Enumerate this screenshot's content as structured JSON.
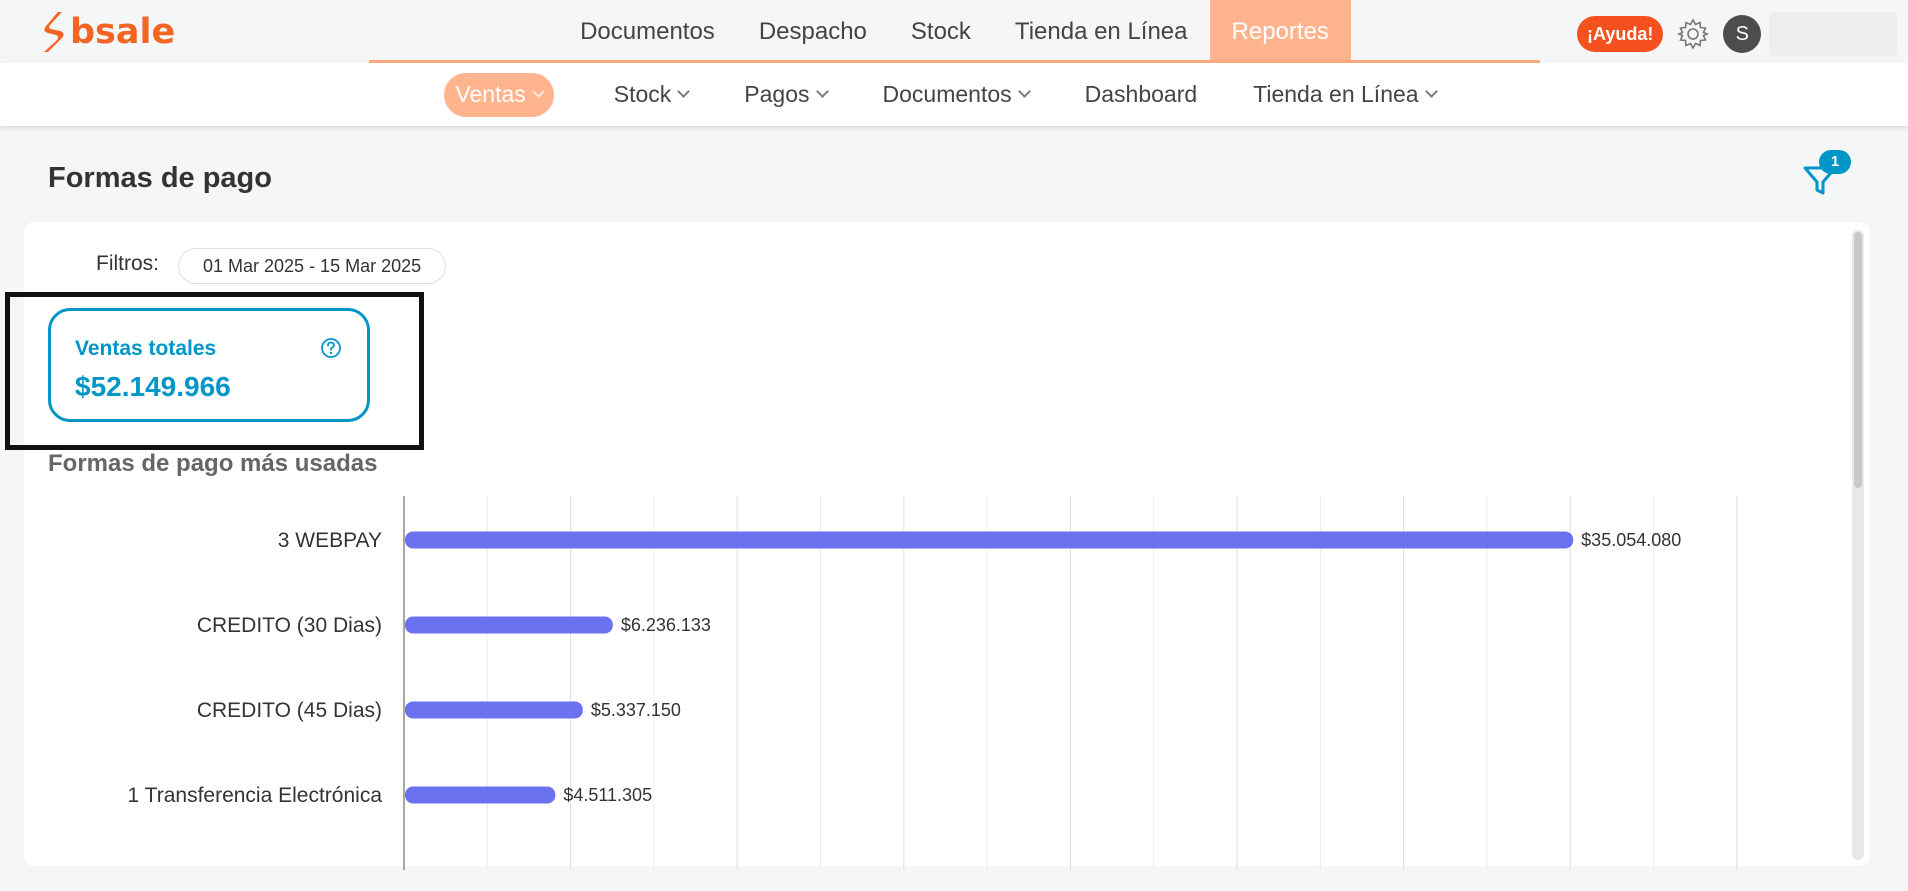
{
  "app": {
    "logo_text": "bsale",
    "accent": "#f26522"
  },
  "main_nav": {
    "items": [
      {
        "label": "Documentos",
        "active": false
      },
      {
        "label": "Despacho",
        "active": false
      },
      {
        "label": "Stock",
        "active": false
      },
      {
        "label": "Tienda en Línea",
        "active": false
      },
      {
        "label": "Reportes",
        "active": true
      }
    ]
  },
  "tools": {
    "help_label": "¡Ayuda!",
    "avatar_initial": "S",
    "icons": [
      "gear-icon"
    ]
  },
  "sub_nav": {
    "items": [
      {
        "label": "Ventas",
        "active": true,
        "dropdown": true
      },
      {
        "label": "Stock",
        "active": false,
        "dropdown": true
      },
      {
        "label": "Pagos",
        "active": false,
        "dropdown": true
      },
      {
        "label": "Documentos",
        "active": false,
        "dropdown": true
      },
      {
        "label": "Dashboard",
        "active": false,
        "dropdown": false
      },
      {
        "label": "Tienda en Línea",
        "active": false,
        "dropdown": true
      }
    ]
  },
  "page": {
    "title": "Formas de pago",
    "filter_badge": "1",
    "filters_label": "Filtros:",
    "date_range": "01 Mar 2025 - 15 Mar 2025"
  },
  "kpi": {
    "label": "Ventas totales",
    "value": "$52.149.966",
    "color": "#0096c7"
  },
  "section": {
    "title": "Formas de pago más usadas"
  },
  "chart_data": {
    "type": "bar",
    "orientation": "horizontal",
    "categories": [
      "3 WEBPAY",
      "CREDITO (30 Dias)",
      "CREDITO (45 Dias)",
      "1 Transferencia Electrónica"
    ],
    "values": [
      35054080,
      6236133,
      5337150,
      4511305
    ],
    "value_labels": [
      "$35.054.080",
      "$6.236.133",
      "$5.337.150",
      "$4.511.305"
    ],
    "xlim": [
      0,
      40000000
    ],
    "grid": true,
    "bar_color": "#6a72f0"
  }
}
